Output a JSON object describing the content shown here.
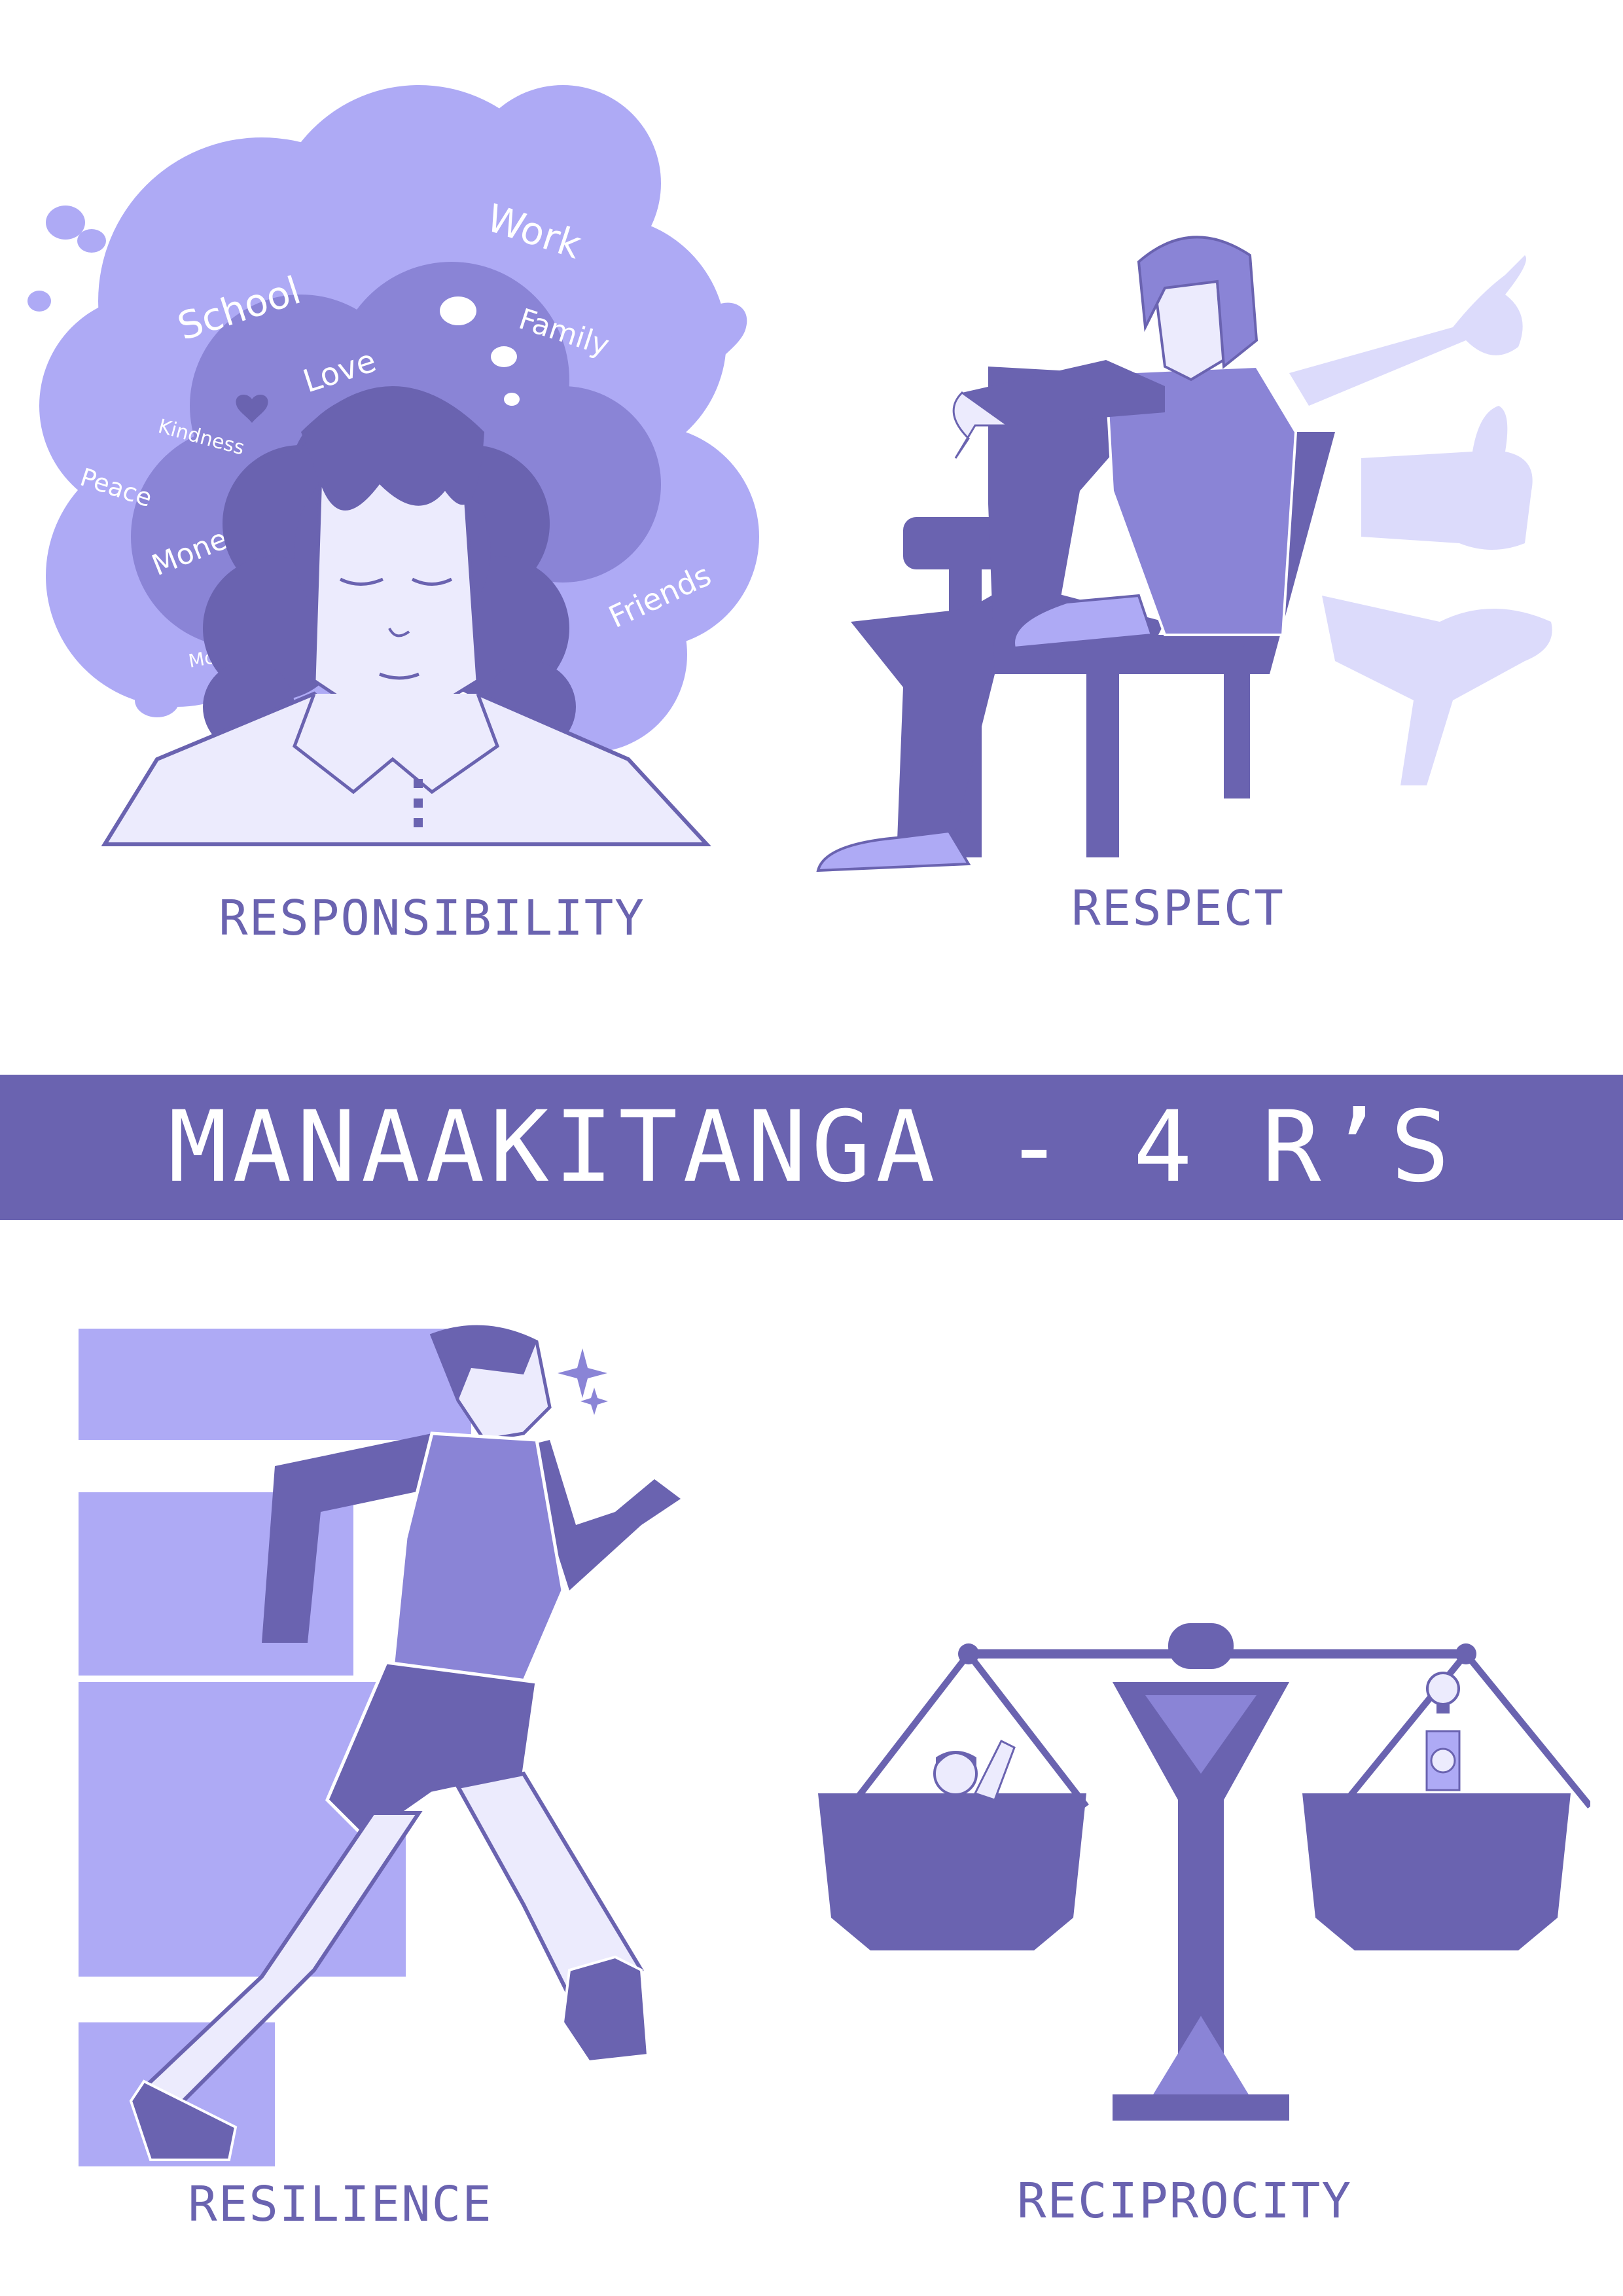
{
  "banner": {
    "title": "MANAAKITANGA - 4 R’S"
  },
  "panels": {
    "responsibility": {
      "caption": "RESPONSIBILITY",
      "thoughts": [
        "School",
        "Work",
        "Family",
        "Love",
        "Kindness",
        "Peace",
        "Money",
        "Friends",
        "Morality"
      ]
    },
    "respect": {
      "caption": "RESPECT"
    },
    "resilience": {
      "caption": "RESILIENCE"
    },
    "reciprocity": {
      "caption": "RECIPROCITY"
    }
  },
  "colors": {
    "dark": "#6a63b0",
    "mid": "#8a84d6",
    "light": "#aeaaf5",
    "pale": "#dcdbfb",
    "paler": "#ecebfd"
  }
}
